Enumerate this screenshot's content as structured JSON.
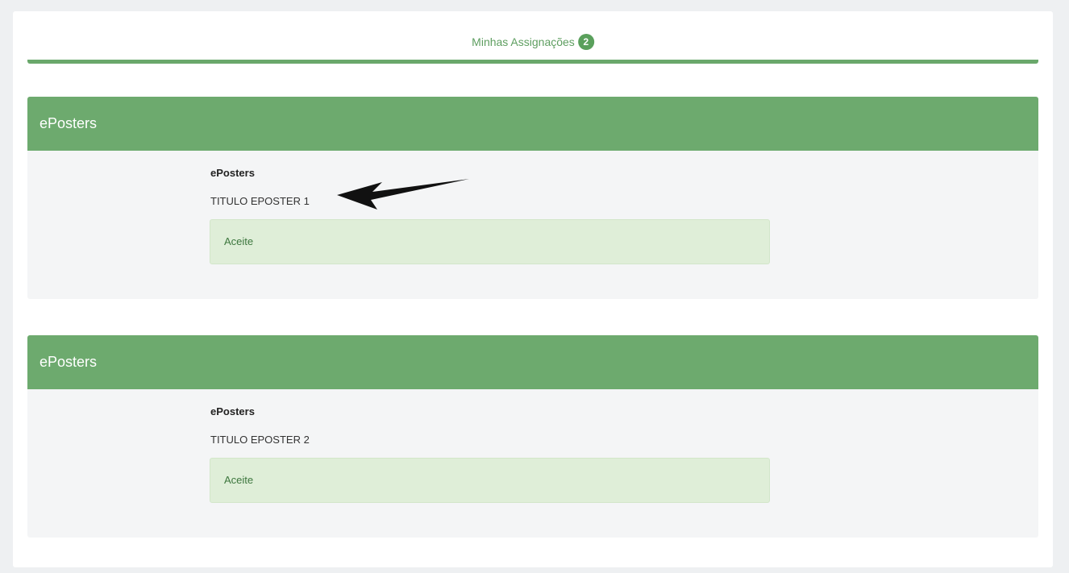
{
  "tab": {
    "label": "Minhas Assignações",
    "count": "2"
  },
  "colors": {
    "accent": "#6daa6e",
    "status_bg": "#dfeed8",
    "status_text": "#3c763d"
  },
  "panels": [
    {
      "heading": "ePosters",
      "category": "ePosters",
      "title": "TITULO EPOSTER 1",
      "status": "Aceite"
    },
    {
      "heading": "ePosters",
      "category": "ePosters",
      "title": "TITULO EPOSTER 2",
      "status": "Aceite"
    }
  ],
  "annotation": {
    "icon": "arrow-pointer-icon"
  }
}
